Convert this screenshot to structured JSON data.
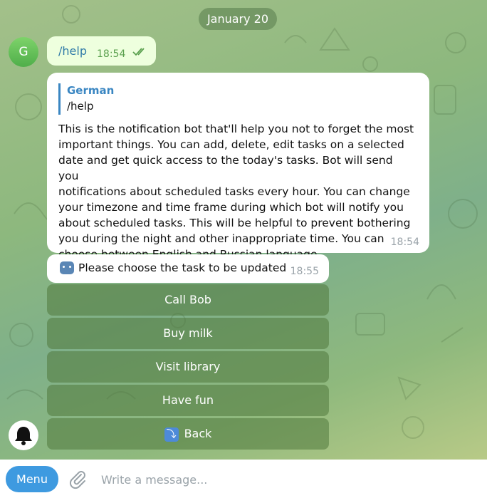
{
  "chat": {
    "date": "January 20",
    "avatar_letter": "G",
    "outgoing": {
      "text": "/help",
      "time": "18:54"
    },
    "reply": {
      "quote_name": "German",
      "quote_text": "/help",
      "lines": [
        "This is the notification bot that'll help you not to forget the most",
        "important things. You can add, delete, edit tasks on a selected",
        "date and get quick access to the today's tasks. Bot will send you",
        "notifications about scheduled tasks every hour. You can change",
        "your timezone and time frame during which bot will notify you",
        "about scheduled tasks. This will be helpful to prevent bothering",
        "you during the night and other inappropriate time. You can",
        "choose between English and Russian language."
      ],
      "time": "18:54"
    },
    "prompt": {
      "text": "Please choose the task to be updated",
      "time": "18:55",
      "icon": "robot-emoji"
    },
    "keyboard": [
      "Call Bob",
      "Buy milk",
      "Visit library",
      "Have fun",
      "Back"
    ],
    "back_icon": "back-arrow-emoji"
  },
  "composer": {
    "menu_label": "Menu",
    "placeholder": "Write a message..."
  },
  "colors": {
    "accent": "#3e9ae0",
    "outgoing_bubble": "#eeffde",
    "incoming_bubble": "#ffffff",
    "keyboard_button": "#5f8a4c"
  }
}
